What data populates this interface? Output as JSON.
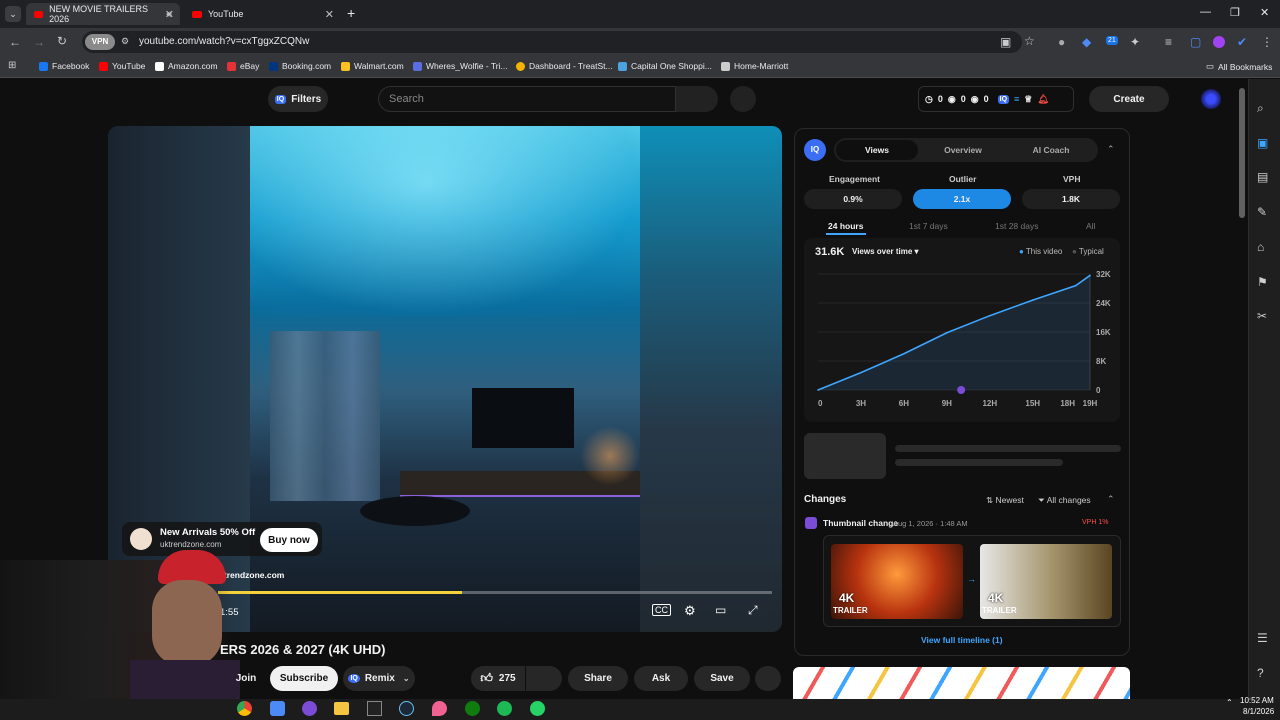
{
  "browser": {
    "tabs": [
      {
        "title": "NEW MOVIE TRAILERS 2026",
        "active": true
      },
      {
        "title": "YouTube",
        "active": false
      }
    ],
    "url": "youtube.com/watch?v=cxTggxZCQNw",
    "vpn_label": "VPN",
    "extension_badge": "21",
    "bookmarks": [
      {
        "label": "Facebook",
        "color": "#1877f2"
      },
      {
        "label": "YouTube",
        "color": "#ff0000"
      },
      {
        "label": "Amazon.com",
        "color": "#ffffff"
      },
      {
        "label": "eBay",
        "color": "#e53238"
      },
      {
        "label": "Booking.com",
        "color": "#003580"
      },
      {
        "label": "Walmart.com",
        "color": "#ffc220"
      },
      {
        "label": "Wheres_Wolfie - Tri...",
        "color": "#5b6ee1"
      },
      {
        "label": "Dashboard - TreatSt...",
        "color": "#f4b400"
      },
      {
        "label": "Capital One Shoppi...",
        "color": "#4aa3df"
      },
      {
        "label": "Home-Marriott",
        "color": "#cccccc"
      }
    ],
    "all_bookmarks": "All Bookmarks"
  },
  "header": {
    "filters": "Filters",
    "search_placeholder": "Search",
    "stats": [
      "0",
      "0",
      "0"
    ],
    "create": "Create"
  },
  "video": {
    "ad_title": "New Arrivals 50% Off",
    "ad_domain": "uktrendzone.com",
    "ad_domain2": "uktrendzone.com",
    "buy_now": "Buy now",
    "time": "1:55",
    "progress": 0.44
  },
  "below_video": {
    "title": "ERS 2026 & 2027 (4K UHD)",
    "join": "Join",
    "subscribe": "Subscribe",
    "remix": "Remix",
    "likes": "275",
    "share": "Share",
    "ask": "Ask",
    "save": "Save"
  },
  "panel": {
    "tabs": [
      "Views",
      "Overview",
      "AI Coach"
    ],
    "metrics": [
      {
        "label": "Engagement",
        "value": "0.9%"
      },
      {
        "label": "Outlier",
        "value": "2.1x"
      },
      {
        "label": "VPH",
        "value": "1.8K"
      }
    ],
    "time_tabs": [
      "24 hours",
      "1st 7 days",
      "1st 28 days",
      "All"
    ],
    "total": "31.6K",
    "views_dropdown": "Views over time",
    "legend": [
      "This video",
      "Typical"
    ],
    "changes": {
      "title": "Changes",
      "newest": "Newest",
      "all_changes": "All changes",
      "item_title": "Thumbnail change",
      "item_date": "Aug 1, 2026 · 1:48 AM",
      "item_badge": "VPH 1%",
      "thumb_text_1": "4K",
      "thumb_sub_1": "TRAILER",
      "thumb_text_2": "4K",
      "thumb_sub_2": "TRAILER",
      "view_timeline": "View full timeline (1)"
    }
  },
  "chart_data": {
    "type": "line",
    "x": [
      "0",
      "3H",
      "6H",
      "9H",
      "12H",
      "15H",
      "18H",
      "19H"
    ],
    "x_hours": [
      0,
      3,
      6,
      9,
      12,
      15,
      18,
      19
    ],
    "series": [
      {
        "name": "This video",
        "values": [
          0,
          4800,
          10000,
          15800,
          20500,
          24800,
          28800,
          31600
        ]
      }
    ],
    "ylim": [
      0,
      32000
    ],
    "yticks": [
      "0",
      "8K",
      "16K",
      "24K",
      "32K"
    ],
    "accent": "#3ea6ff"
  },
  "taskbar": {
    "time": "10:52 AM",
    "date": "8/1/2026"
  }
}
